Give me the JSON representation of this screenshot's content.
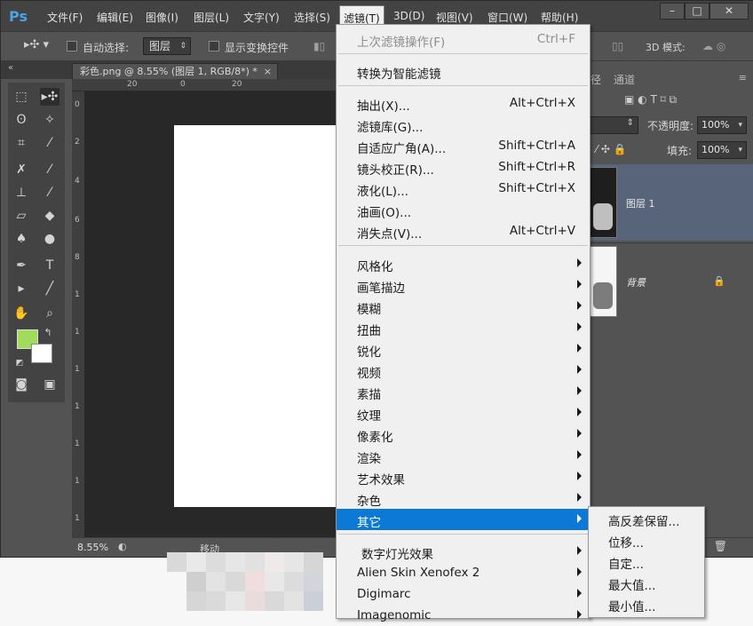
{
  "menubar": {
    "logo": "Ps",
    "items": [
      "文件(F)",
      "编辑(E)",
      "图像(I)",
      "图层(L)",
      "文字(Y)",
      "选择(S)",
      "滤镜(T)",
      "3D(D)",
      "视图(V)",
      "窗口(W)",
      "帮助(H)"
    ],
    "active_item": "滤镜(T)",
    "window_buttons": [
      "–",
      "□",
      "✕"
    ]
  },
  "optionsbar": {
    "auto_select_label": "自动选择:",
    "auto_select_value": "图层",
    "show_transform_label": "显示变换控件",
    "mode_3d_label": "3D 模式:"
  },
  "document_tab": {
    "title": "彩色.png @ 8.55% (图层 1, RGB/8*) *",
    "close": "×"
  },
  "rulers": {
    "top_ticks": [
      "20",
      "0",
      "20"
    ],
    "left_ticks": [
      "0",
      "2",
      "4",
      "6",
      "8",
      "1",
      "1",
      "1",
      "1",
      "1",
      "1",
      "1"
    ]
  },
  "statusbar": {
    "zoom": "8.55%",
    "info": "移动"
  },
  "layers_panel": {
    "tabs": [
      "径",
      "通道"
    ],
    "opacity_label": "不透明度:",
    "opacity_value": "100%",
    "fill_label": "填充:",
    "fill_value": "100%",
    "layers": [
      {
        "name": "图层 1",
        "selected": true
      },
      {
        "name": "背景",
        "locked": true
      }
    ]
  },
  "filter_menu": {
    "items": [
      {
        "label": "上次滤镜操作(F)",
        "shortcut": "Ctrl+F",
        "disabled": true
      },
      {
        "label": "转换为智能滤镜"
      },
      {
        "label": "抽出(X)...",
        "shortcut": "Alt+Ctrl+X"
      },
      {
        "label": "滤镜库(G)..."
      },
      {
        "label": "自适应广角(A)...",
        "shortcut": "Shift+Ctrl+A"
      },
      {
        "label": "镜头校正(R)...",
        "shortcut": "Shift+Ctrl+R"
      },
      {
        "label": "液化(L)...",
        "shortcut": "Shift+Ctrl+X"
      },
      {
        "label": "油画(O)..."
      },
      {
        "label": "消失点(V)...",
        "shortcut": "Alt+Ctrl+V"
      },
      {
        "label": "风格化",
        "submenu": true
      },
      {
        "label": "画笔描边",
        "submenu": true
      },
      {
        "label": "模糊",
        "submenu": true
      },
      {
        "label": "扭曲",
        "submenu": true
      },
      {
        "label": "锐化",
        "submenu": true
      },
      {
        "label": "视频",
        "submenu": true
      },
      {
        "label": "素描",
        "submenu": true
      },
      {
        "label": "纹理",
        "submenu": true
      },
      {
        "label": "像素化",
        "submenu": true
      },
      {
        "label": "渲染",
        "submenu": true
      },
      {
        "label": "艺术效果",
        "submenu": true
      },
      {
        "label": "杂色",
        "submenu": true
      },
      {
        "label": "其它",
        "submenu": true,
        "highlighted": true
      },
      {
        "label": "数字灯光效果",
        "submenu": true
      },
      {
        "label": "Alien Skin Xenofex 2",
        "submenu": true
      },
      {
        "label": "Digimarc",
        "submenu": true
      },
      {
        "label": "Imagenomic",
        "submenu": true
      }
    ]
  },
  "other_submenu": {
    "items": [
      "高反差保留...",
      "位移...",
      "自定...",
      "最大值...",
      "最小值..."
    ]
  },
  "colors": {
    "foreground": "#a0db5c",
    "background": "#ffffff",
    "menu_highlight": "#0d79d6",
    "layer_selected": "#586479"
  }
}
